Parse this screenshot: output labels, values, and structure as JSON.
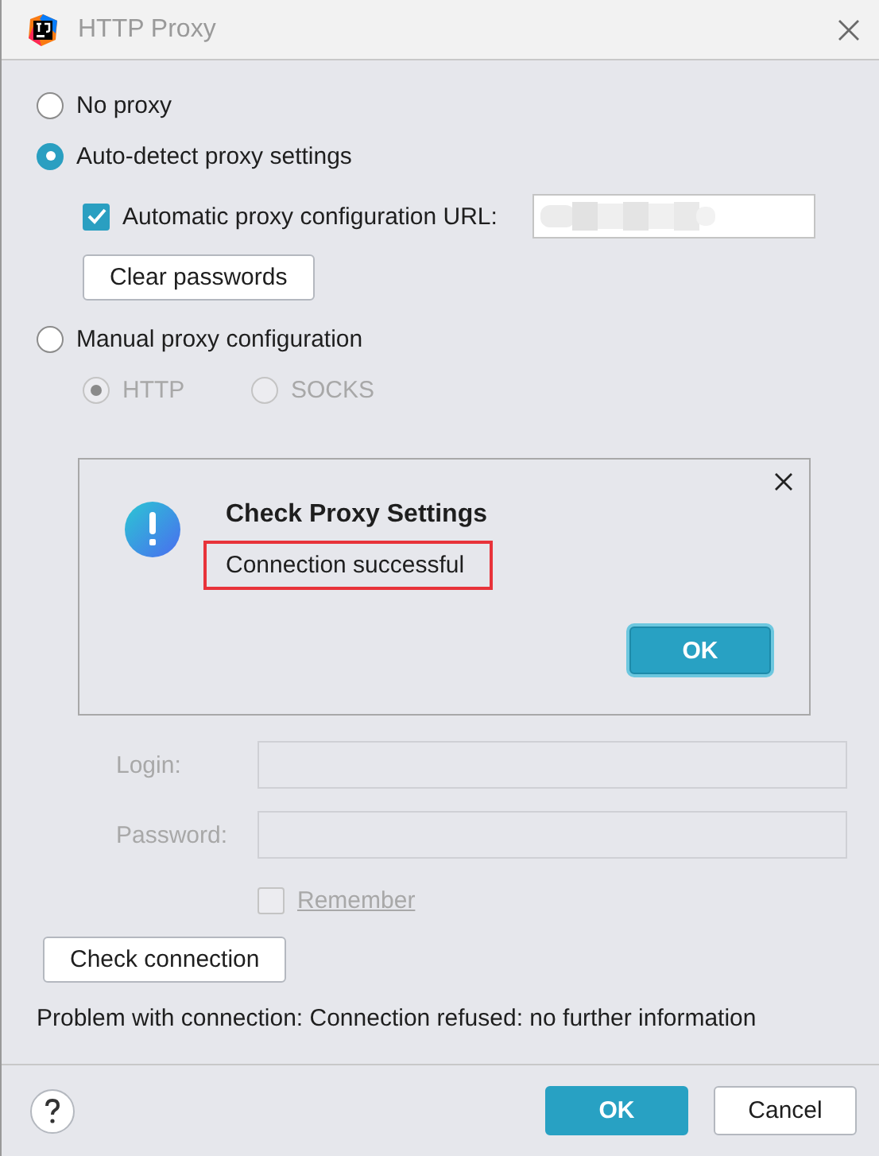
{
  "window": {
    "title": "HTTP Proxy"
  },
  "proxy_modes": [
    {
      "label": "No proxy",
      "selected": false,
      "disabled": false
    },
    {
      "label": "Auto-detect proxy settings",
      "selected": true,
      "disabled": false
    }
  ],
  "auto_config": {
    "label": "Automatic proxy configuration URL:",
    "checked": true
  },
  "clear_passwords_button": "Clear passwords",
  "manual_mode": {
    "label": "Manual proxy configuration",
    "selected": false
  },
  "protocols": [
    {
      "label": "HTTP",
      "selected": true,
      "disabled": true
    },
    {
      "label": "SOCKS",
      "selected": false,
      "disabled": true
    }
  ],
  "auth_fields": [
    {
      "label": "Login:",
      "disabled": true
    },
    {
      "label": "Password:",
      "disabled": true
    }
  ],
  "remember": {
    "label": "Remember",
    "checked": false,
    "disabled": true
  },
  "check_connection_button": "Check connection",
  "status_message": "Problem with connection: Connection refused: no further information",
  "footer_buttons": [
    {
      "label": "OK",
      "kind": "primary"
    },
    {
      "label": "Cancel",
      "kind": "secondary"
    }
  ],
  "popup": {
    "title": "Check Proxy Settings",
    "message": "Connection successful",
    "button": "OK"
  }
}
